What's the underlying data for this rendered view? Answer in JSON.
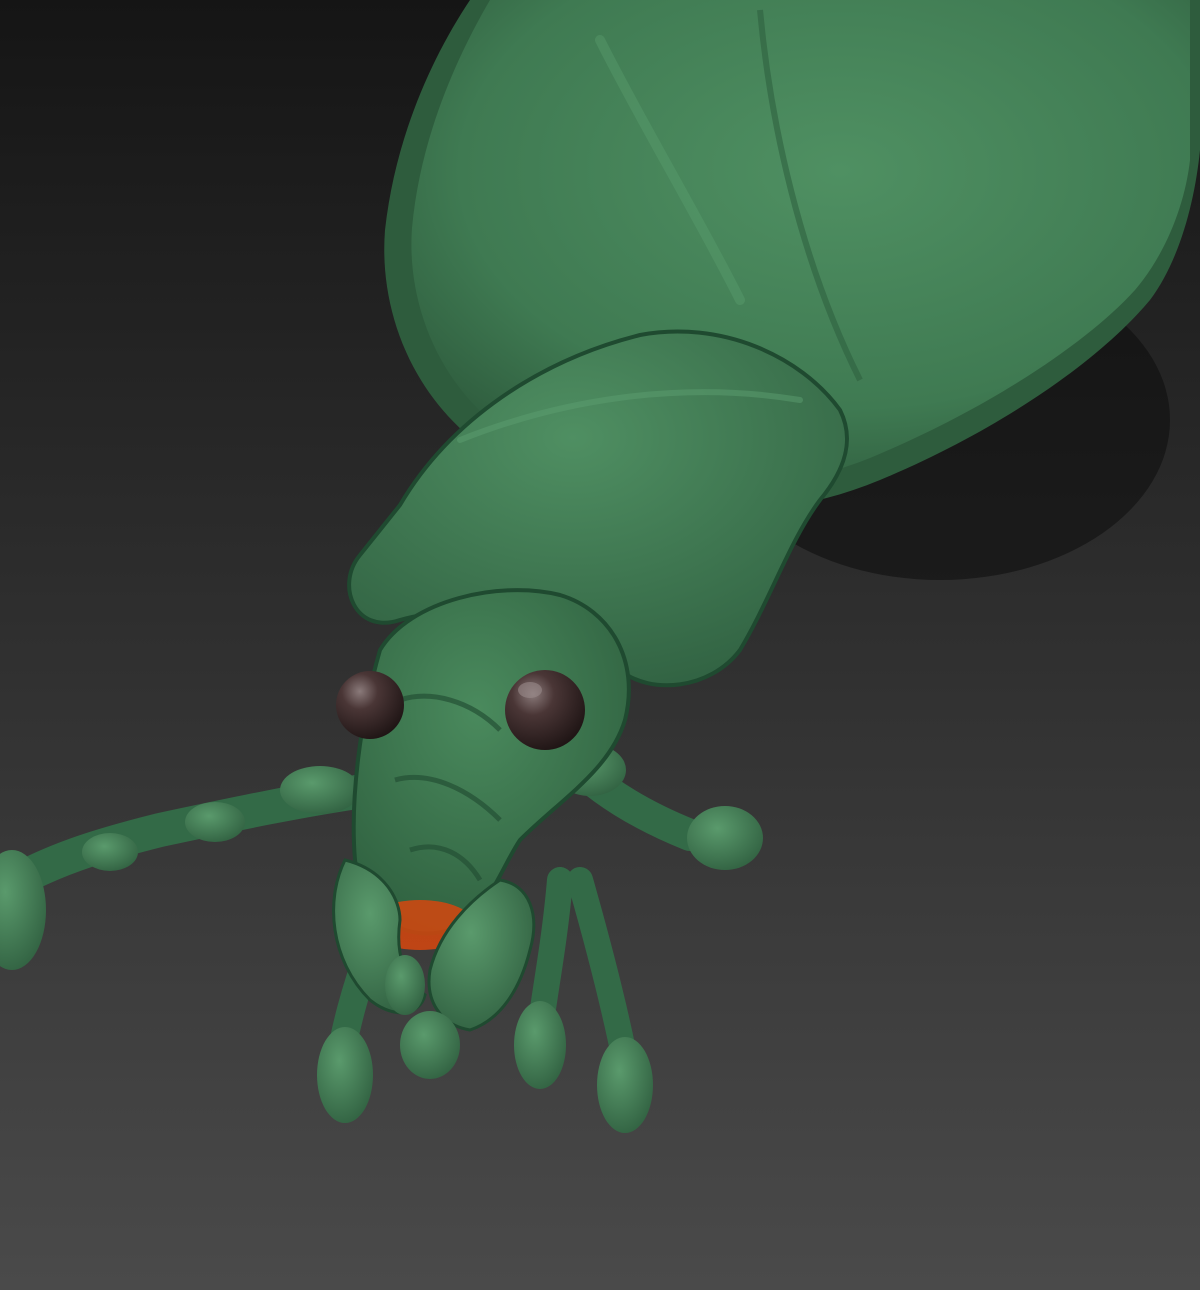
{
  "scene": {
    "subject": "beetle-sculpt",
    "colors": {
      "background_top": "#151515",
      "background_bottom": "#4a4a4a",
      "body": "#3f7a52",
      "body_light": "#5a9a6c",
      "body_dark": "#22452f",
      "eye": "#3a2a2a",
      "eye_highlight": "#8a7a7a",
      "mouth": "#d6460e"
    }
  }
}
